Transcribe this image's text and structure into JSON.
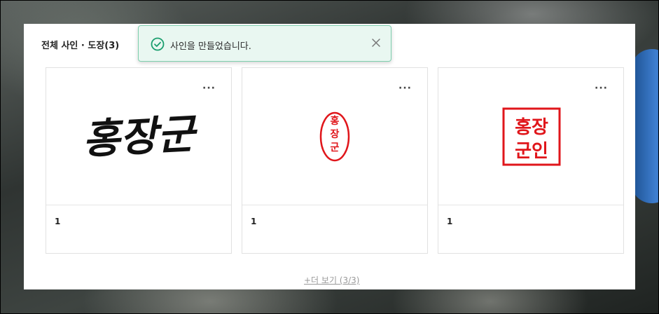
{
  "panel": {
    "title": "전체 사인 · 도장(3)"
  },
  "toast": {
    "message": "사인을 만들었습니다.",
    "close_icon": "close-icon",
    "status_icon": "check-circle-icon",
    "accent": "#1a9e6e"
  },
  "cards": [
    {
      "label": "1",
      "menu_icon": "more-horizontal-icon",
      "preview_text": "홍장군",
      "kind": "signature"
    },
    {
      "label": "1",
      "menu_icon": "more-horizontal-icon",
      "preview_lines": [
        "홍",
        "장",
        "군"
      ],
      "kind": "oval-stamp",
      "color": "#e0161b"
    },
    {
      "label": "1",
      "menu_icon": "more-horizontal-icon",
      "preview_lines": [
        "홍장",
        "군인"
      ],
      "kind": "square-stamp",
      "color": "#e0161b"
    }
  ],
  "footer": {
    "more_label": "+더 보기 (3/3)"
  }
}
